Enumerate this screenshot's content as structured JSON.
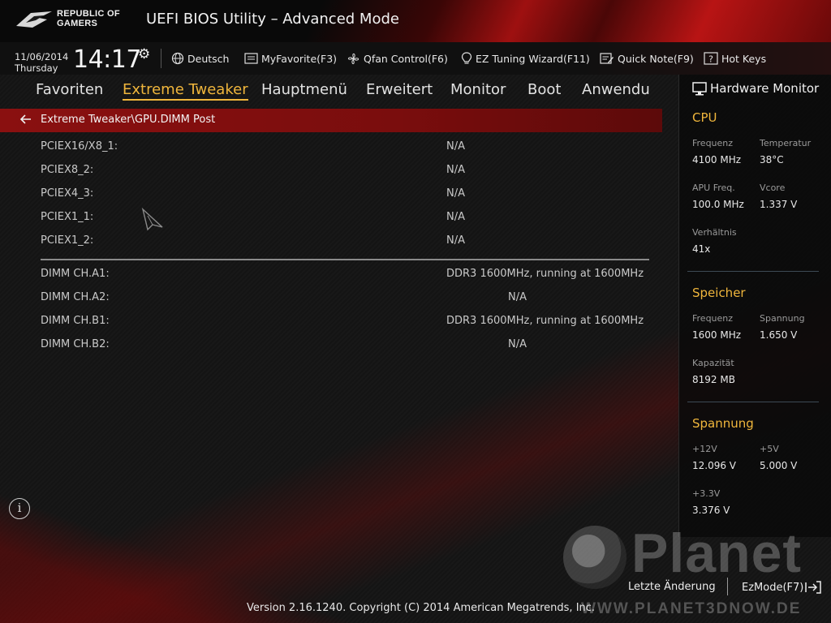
{
  "header": {
    "brand_line1": "REPUBLIC OF",
    "brand_line2": "GAMERS",
    "title": "UEFI BIOS Utility – Advanced Mode"
  },
  "toolbar": {
    "date": "11/06/2014",
    "day": "Thursday",
    "time": "14:17",
    "language": "Deutsch",
    "myfavorite": "MyFavorite(F3)",
    "qfan": "Qfan Control(F6)",
    "ez_tuning": "EZ Tuning Wizard(F11)",
    "quick_note": "Quick Note(F9)",
    "hot_keys": "Hot Keys"
  },
  "tabs": [
    {
      "label": "Favoriten",
      "active": false
    },
    {
      "label": "Extreme Tweaker",
      "active": true
    },
    {
      "label": "Hauptmenü",
      "active": false
    },
    {
      "label": "Erweitert",
      "active": false
    },
    {
      "label": "Monitor",
      "active": false
    },
    {
      "label": "Boot",
      "active": false
    },
    {
      "label": "Anwendu",
      "active": false
    }
  ],
  "breadcrumb": "Extreme Tweaker\\GPU.DIMM Post",
  "pcie_rows": [
    {
      "label": "PCIEX16/X8_1:",
      "value": "N/A"
    },
    {
      "label": "PCIEX8_2:",
      "value": "N/A"
    },
    {
      "label": "PCIEX4_3:",
      "value": "N/A"
    },
    {
      "label": "PCIEX1_1:",
      "value": "N/A"
    },
    {
      "label": "PCIEX1_2:",
      "value": "N/A"
    }
  ],
  "dimm_rows": [
    {
      "label": "DIMM CH.A1:",
      "value": "DDR3 1600MHz, running at 1600MHz"
    },
    {
      "label": "DIMM CH.A2:",
      "value": "N/A"
    },
    {
      "label": "DIMM CH.B1:",
      "value": "DDR3 1600MHz, running at 1600MHz"
    },
    {
      "label": "DIMM CH.B2:",
      "value": "N/A"
    }
  ],
  "hw_monitor": {
    "title": "Hardware Monitor",
    "cpu": {
      "heading": "CPU",
      "freq_label": "Frequenz",
      "freq_value": "4100 MHz",
      "temp_label": "Temperatur",
      "temp_value": "38°C",
      "apu_label": "APU Freq.",
      "apu_value": "100.0 MHz",
      "vcore_label": "Vcore",
      "vcore_value": "1.337 V",
      "ratio_label": "Verhältnis",
      "ratio_value": "41x"
    },
    "memory": {
      "heading": "Speicher",
      "freq_label": "Frequenz",
      "freq_value": "1600 MHz",
      "volt_label": "Spannung",
      "volt_value": "1.650 V",
      "cap_label": "Kapazität",
      "cap_value": "8192 MB"
    },
    "voltage": {
      "heading": "Spannung",
      "v12_label": "+12V",
      "v12_value": "12.096 V",
      "v5_label": "+5V",
      "v5_value": "5.000 V",
      "v33_label": "+3.3V",
      "v33_value": "3.376 V"
    }
  },
  "footer": {
    "last_change": "Letzte Änderung",
    "ez_mode": "EzMode(F7)",
    "copyright": "Version 2.16.1240. Copyright (C) 2014 American Megatrends, Inc."
  },
  "watermark": {
    "brand": "Planet",
    "url": "WWW.PLANET3DNOW.DE"
  },
  "colors": {
    "accent": "#f0b63c",
    "crumb_bar": "#8a1010",
    "header_red": "#b81414"
  }
}
